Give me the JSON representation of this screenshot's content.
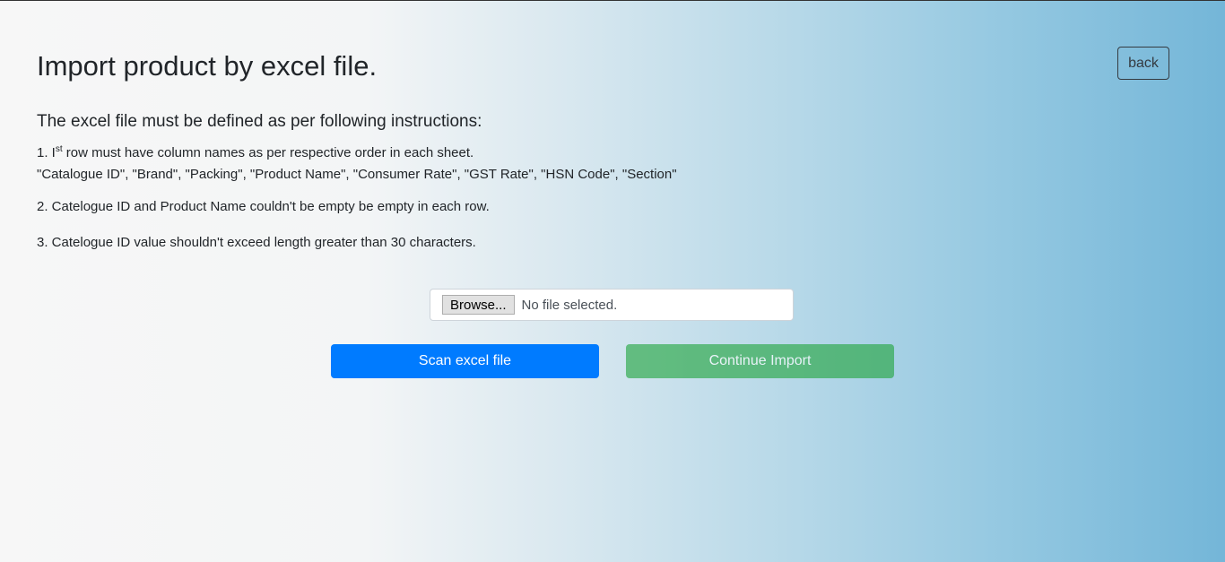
{
  "page": {
    "title": "Import product by excel file.",
    "back_label": "back"
  },
  "instructions": {
    "heading": "The excel file must be defined as per following instructions:",
    "item1_prefix": "1. I",
    "item1_sup": "st",
    "item1_rest": " row must have column names as per respective order in each sheet.",
    "item1_columns": "\"Catalogue ID\", \"Brand\", \"Packing\", \"Product Name\", \"Consumer Rate\", \"GST Rate\", \"HSN Code\", \"Section\"",
    "item2": "2. Catelogue ID and Product Name couldn't be empty be empty in each row.",
    "item3": "3. Catelogue ID value shouldn't exceed length greater than 30 characters."
  },
  "file_input": {
    "browse_label": "Browse...",
    "status": "No file selected."
  },
  "actions": {
    "scan_label": "Scan excel file",
    "continue_label": "Continue Import"
  }
}
